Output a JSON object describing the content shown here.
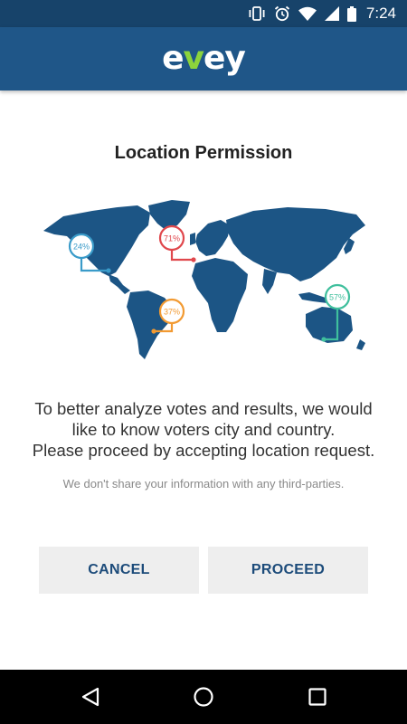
{
  "status_bar": {
    "time": "7:24",
    "icons": [
      "vibrate-icon",
      "alarm-icon",
      "wifi-icon",
      "cell-signal-icon",
      "battery-icon"
    ]
  },
  "app_bar": {
    "logo_part1": "e",
    "logo_part2": "v",
    "logo_part3": "ey",
    "brand_color": "#1f5688",
    "logo_accent_color": "#8cd43c"
  },
  "title": "Location Permission",
  "map": {
    "pins": [
      {
        "label": "24%",
        "color": "#3a9bc9"
      },
      {
        "label": "71%",
        "color": "#e0474c"
      },
      {
        "label": "37%",
        "color": "#f29a32"
      },
      {
        "label": "57%",
        "color": "#3fbf9d"
      }
    ]
  },
  "description_line1": "To better analyze votes and results, we would",
  "description_line2": "like to know voters city and country.",
  "description_line3": "Please proceed by accepting location request.",
  "note": "We don't share your information with any third-parties.",
  "buttons": {
    "cancel": "CANCEL",
    "proceed": "PROCEED"
  },
  "nav_bar": {
    "icons": [
      "back-icon",
      "home-icon",
      "recents-icon"
    ]
  }
}
